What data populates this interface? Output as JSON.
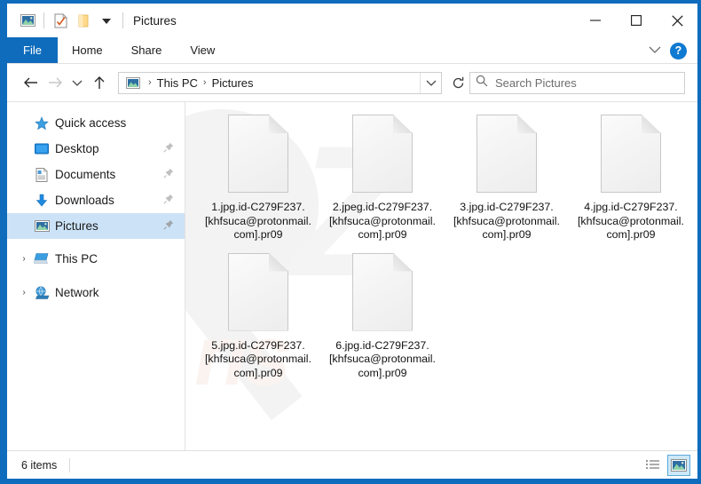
{
  "window": {
    "title": "Pictures",
    "quick_access_icons": [
      "pictures-icon",
      "properties-check-icon",
      "new-folder-icon",
      "customize-chevron-icon"
    ],
    "controls": {
      "minimize": "–",
      "maximize": "□",
      "close": "✕"
    }
  },
  "ribbon": {
    "tabs": [
      {
        "label": "File",
        "active": true
      },
      {
        "label": "Home",
        "active": false
      },
      {
        "label": "Share",
        "active": false
      },
      {
        "label": "View",
        "active": false
      }
    ],
    "collapse_icon": "chevron-down-icon",
    "help_label": "?"
  },
  "navbar": {
    "back": "back-arrow-icon",
    "forward": "forward-arrow-icon",
    "recent": "recent-locations-icon",
    "up": "up-arrow-icon",
    "breadcrumbs": [
      "This PC",
      "Pictures"
    ],
    "breadcrumb_separator": "›",
    "dropdown_icon": "chevron-down-icon",
    "refresh_icon": "refresh-icon"
  },
  "search": {
    "placeholder": "Search Pictures",
    "icon": "search-icon"
  },
  "sidebar": {
    "items": [
      {
        "label": "Quick access",
        "icon": "star-icon",
        "expander": "ⱟ",
        "level": 0,
        "pinned": false,
        "selected": false
      },
      {
        "label": "Desktop",
        "icon": "desktop-icon",
        "expander": "",
        "level": 1,
        "pinned": true,
        "selected": false
      },
      {
        "label": "Documents",
        "icon": "documents-icon",
        "expander": "",
        "level": 1,
        "pinned": true,
        "selected": false
      },
      {
        "label": "Downloads",
        "icon": "downloads-icon",
        "expander": "",
        "level": 1,
        "pinned": true,
        "selected": false
      },
      {
        "label": "Pictures",
        "icon": "pictures-icon",
        "expander": "",
        "level": 1,
        "pinned": true,
        "selected": true
      },
      {
        "label": "This PC",
        "icon": "this-pc-icon",
        "expander": "›",
        "level": 0,
        "pinned": false,
        "selected": false
      },
      {
        "label": "Network",
        "icon": "network-icon",
        "expander": "›",
        "level": 0,
        "pinned": false,
        "selected": false
      }
    ]
  },
  "files": [
    {
      "name": "1.jpg.id-C279F237.[khfsuca@protonmail.com].pr09",
      "icon": "blank-file-icon"
    },
    {
      "name": "2.jpeg.id-C279F237.[khfsuca@protonmail.com].pr09",
      "icon": "blank-file-icon"
    },
    {
      "name": "3.jpg.id-C279F237.[khfsuca@protonmail.com].pr09",
      "icon": "blank-file-icon"
    },
    {
      "name": "4.jpg.id-C279F237.[khfsuca@protonmail.com].pr09",
      "icon": "blank-file-icon"
    },
    {
      "name": "5.jpg.id-C279F237.[khfsuca@protonmail.com].pr09",
      "icon": "blank-file-icon"
    },
    {
      "name": "6.jpg.id-C279F237.[khfsuca@protonmail.com].pr09",
      "icon": "blank-file-icon"
    }
  ],
  "statusbar": {
    "item_count": "6 items",
    "views": [
      {
        "name": "details-view",
        "active": false
      },
      {
        "name": "large-icons-view",
        "active": true
      }
    ]
  },
  "watermark": {
    "mark": "ris",
    "letter": "Z"
  },
  "colors": {
    "frame_blue": "#0f6cbd",
    "selection_blue": "#cce3f7",
    "accent": "#0f7ad1"
  }
}
